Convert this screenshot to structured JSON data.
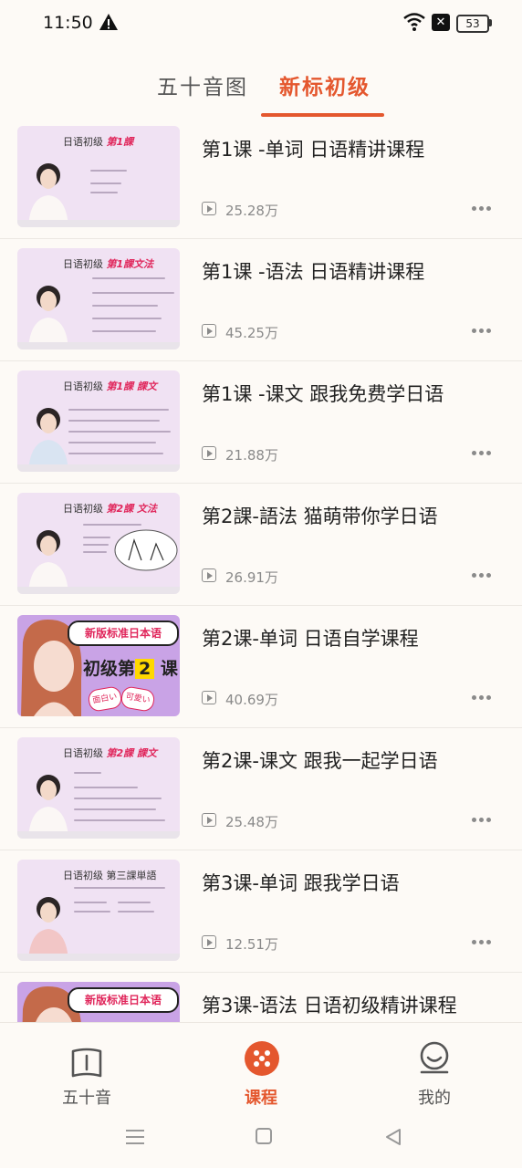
{
  "status_bar": {
    "time": "11:50",
    "battery": "53",
    "icons": [
      "warning-icon",
      "wifi-icon",
      "notification-x-icon",
      "battery-icon"
    ]
  },
  "tabs": [
    {
      "label": "五十音图",
      "active": false
    },
    {
      "label": "新标初级",
      "active": true
    }
  ],
  "accent_color": "#e4572e",
  "lessons": [
    {
      "title": "第1课 -单词 日语精讲课程",
      "views": "25.28万",
      "thumb_header": "日语初级",
      "thumb_header_red": "第1課"
    },
    {
      "title": "第1课 -语法  日语精讲课程",
      "views": "45.25万",
      "thumb_header": "日语初级",
      "thumb_header_red": "第1課文法"
    },
    {
      "title": "第1课 -课文 跟我免费学日语",
      "views": "21.88万",
      "thumb_header": "日语初级",
      "thumb_header_red": "第1課 課文"
    },
    {
      "title": "第2課-語法 猫萌带你学日语",
      "views": "26.91万",
      "thumb_header": "日语初级",
      "thumb_header_red": "第2課 文法"
    },
    {
      "title": "第2课-单词 日语自学课程",
      "views": "40.69万",
      "promo": true,
      "promo_pill": "新版标准日本语",
      "promo_big_pre": "初级第",
      "promo_num": "2",
      "promo_big_post": "课"
    },
    {
      "title": "第2课-课文 跟我一起学日语",
      "views": "25.48万",
      "thumb_header": "日语初级",
      "thumb_header_red": "第2課 課文"
    },
    {
      "title": "第3课-单词 跟我学日语",
      "views": "12.51万",
      "thumb_header": "日语初级",
      "thumb_header_red": "第三課単語"
    },
    {
      "title": "第3课-语法 日语初级精讲课程",
      "views": "",
      "promo": true,
      "promo_pill": "新版标准日本语",
      "promo_big_pre": "",
      "promo_num": "",
      "promo_big_post": ""
    }
  ],
  "bottom_nav": [
    {
      "label": "五十音",
      "icon": "book-icon",
      "active": false
    },
    {
      "label": "课程",
      "icon": "course-icon",
      "active": true
    },
    {
      "label": "我的",
      "icon": "profile-icon",
      "active": false
    }
  ],
  "system_nav": [
    "menu-icon",
    "home-icon",
    "back-icon"
  ]
}
